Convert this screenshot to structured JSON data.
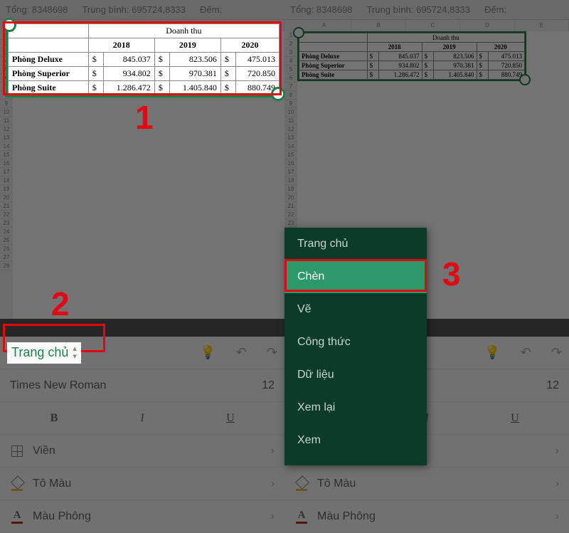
{
  "topbar": {
    "sum": "Tổng: 8348698",
    "avg": "Trung bình: 695724,8333",
    "count": "Đếm:"
  },
  "columns": [
    "A",
    "B",
    "C",
    "D",
    "E"
  ],
  "table": {
    "title": "Doanh thu",
    "years": [
      "2018",
      "2019",
      "2020"
    ],
    "currency": "$",
    "rows": [
      {
        "label": "Phòng Deluxe",
        "v": [
          "845.037",
          "823.506",
          "475.013"
        ]
      },
      {
        "label": "Phòng Superior",
        "v": [
          "934.802",
          "970.381",
          "720.850"
        ]
      },
      {
        "label": "Phòng Suite",
        "v": [
          "1.286.472",
          "1.405.840",
          "880.749"
        ]
      }
    ]
  },
  "ribbon": {
    "tab": "Trang chủ",
    "font": "Times New Roman",
    "size": "12",
    "bold": "B",
    "italic": "I",
    "underline": "U",
    "border": "Viền",
    "fill": "Tô Màu",
    "fontcolor": "Màu Phông"
  },
  "menu": {
    "items": [
      "Trang chủ",
      "Chèn",
      "Vẽ",
      "Công thức",
      "Dữ liệu",
      "Xem lại",
      "Xem"
    ]
  },
  "anno": {
    "n1": "1",
    "n2": "2",
    "n3": "3"
  }
}
